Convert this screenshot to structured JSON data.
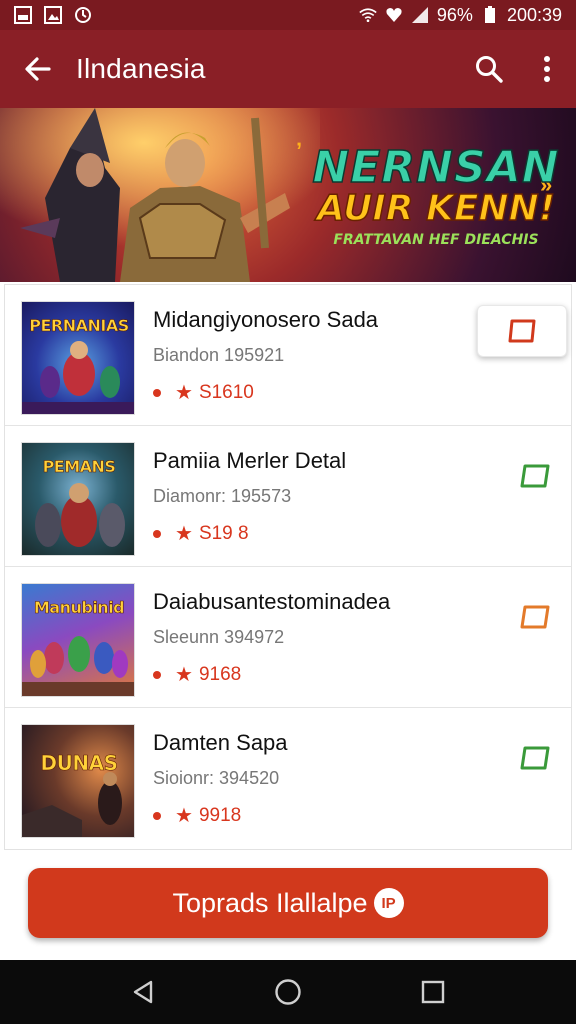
{
  "status_bar": {
    "battery_text": "96%",
    "time": "200:39",
    "icons_left": [
      "image-icon",
      "gallery-icon",
      "sync-icon"
    ],
    "icons_right": [
      "wifi-icon",
      "heart-icon",
      "signal-icon",
      "battery-icon"
    ]
  },
  "app_bar": {
    "title": "Ilndanesia",
    "icons": [
      "back-arrow-icon",
      "search-icon",
      "more-vert-icon"
    ],
    "background_color": "#8a1f26"
  },
  "banner": {
    "title_line1": "NERNSAN",
    "title_line2": "AUIR KENN!",
    "subtitle": "FRATTAVAN HEF DIEACHIS"
  },
  "list": {
    "items": [
      {
        "thumb_text": "PERNANIAS",
        "title": "Midangiyonosero Sada",
        "subtitle": "Biandon 195921",
        "rating": "S1610",
        "action_icon": "square-outline-icon",
        "action_color": "#d1391c"
      },
      {
        "thumb_text": "PEMANS",
        "title": "Pamiia Merler Detal",
        "subtitle": "Diamonr: 195573",
        "rating": "S19 8",
        "action_icon": "square-outline-icon",
        "action_color": "#3a9a3a"
      },
      {
        "thumb_text": "Manubinid",
        "title": "Daiabusantestominadea",
        "subtitle": "Sleeunn 394972",
        "rating": "9168",
        "action_icon": "square-outline-icon",
        "action_color": "#e37a2a"
      },
      {
        "thumb_text": "DUNAS",
        "title": "Damten Sapa",
        "subtitle": "Sioionr: 394520",
        "rating": "9918",
        "action_icon": "square-outline-icon",
        "action_color": "#3a9a3a"
      }
    ]
  },
  "cta": {
    "label": "Toprads Ilallalpe",
    "badge": "IP",
    "color": "#d1391c"
  },
  "nav_bar": {
    "icons": [
      "back-triangle-icon",
      "home-circle-icon",
      "recents-square-icon"
    ]
  }
}
